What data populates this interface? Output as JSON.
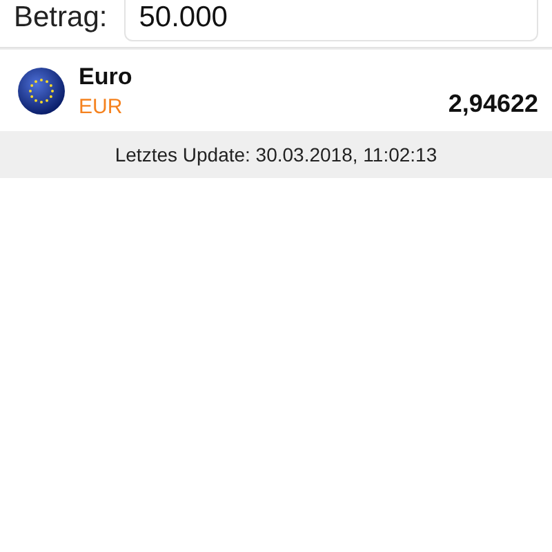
{
  "amount": {
    "label": "Betrag:",
    "value": "50.000"
  },
  "currencies": [
    {
      "name": "Euro",
      "code": "EUR",
      "value": "2,94622"
    }
  ],
  "status_bar": {
    "text": "Letztes Update: 30.03.2018, 11:02:13"
  }
}
